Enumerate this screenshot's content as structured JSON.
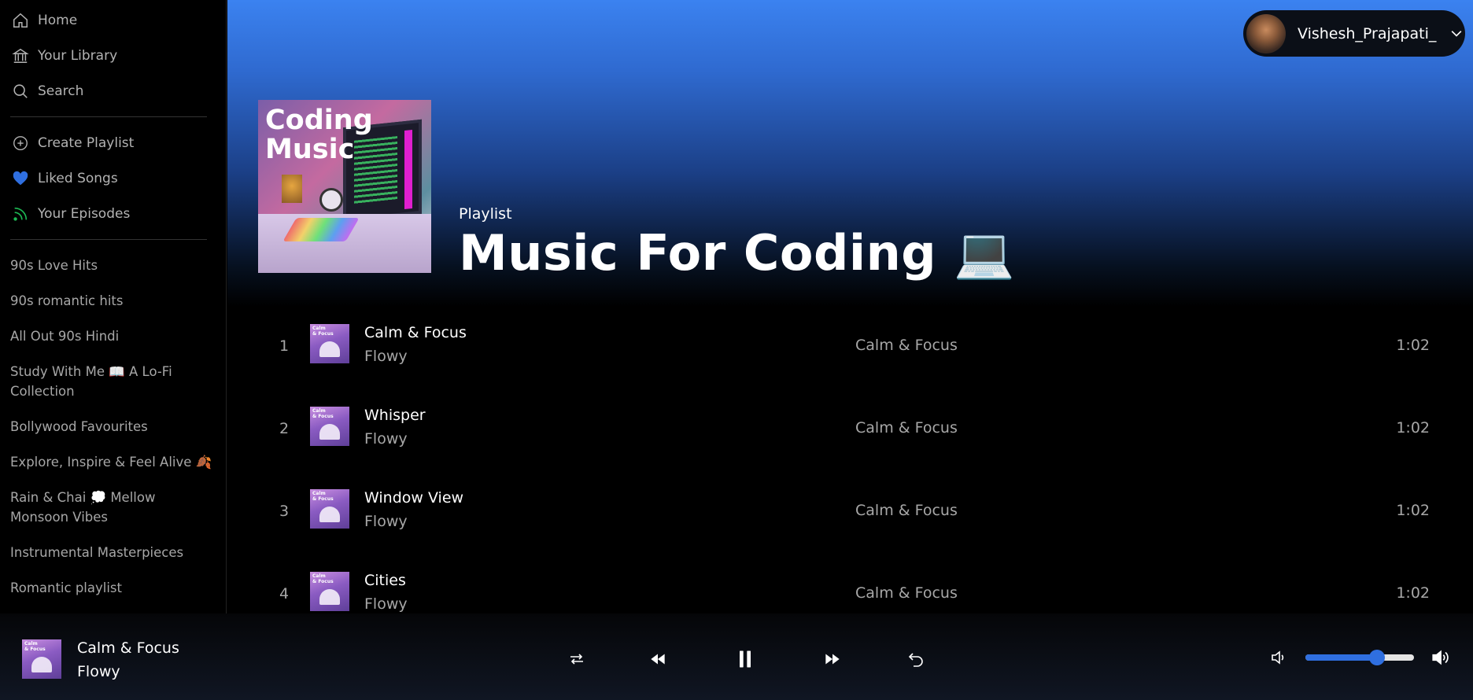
{
  "sidebar": {
    "nav": [
      {
        "label": "Home",
        "icon": "home-icon"
      },
      {
        "label": "Your Library",
        "icon": "library-icon"
      },
      {
        "label": "Search",
        "icon": "search-icon"
      }
    ],
    "actions": [
      {
        "label": "Create Playlist",
        "icon": "plus-circle-icon"
      },
      {
        "label": "Liked Songs",
        "icon": "heart-icon",
        "color": "#2f6fe0"
      },
      {
        "label": "Your Episodes",
        "icon": "rss-icon",
        "color": "#1db954"
      }
    ],
    "playlists": [
      "90s Love Hits",
      "90s romantic hits",
      "All Out 90s Hindi",
      "Study With Me 📖 A Lo-Fi Collection",
      "Bollywood Favourites",
      "Explore, Inspire & Feel Alive 🍂",
      "Rain & Chai 💭 Mellow Monsoon Vibes",
      "Instrumental Masterpieces",
      "Romantic playlist"
    ]
  },
  "header": {
    "user_name": "Vishesh_Prajapati_",
    "cover_title": "Coding\nMusic",
    "type_label": "Playlist",
    "title": "Music For Coding 💻"
  },
  "tracks": [
    {
      "num": "1",
      "title": "Calm & Focus",
      "artist": "Flowy",
      "album": "Calm & Focus",
      "duration": "1:02",
      "art_label": "Calm\n& Focus"
    },
    {
      "num": "2",
      "title": "Whisper",
      "artist": "Flowy",
      "album": "Calm & Focus",
      "duration": "1:02",
      "art_label": "Calm\n& Focus"
    },
    {
      "num": "3",
      "title": "Window View",
      "artist": "Flowy",
      "album": "Calm & Focus",
      "duration": "1:02",
      "art_label": "Calm\n& Focus"
    },
    {
      "num": "4",
      "title": "Cities",
      "artist": "Flowy",
      "album": "Calm & Focus",
      "duration": "1:02",
      "art_label": "Calm\n& Focus"
    }
  ],
  "player": {
    "title": "Calm & Focus",
    "artist": "Flowy",
    "art_label": "Calm\n& Focus",
    "volume": 0.66,
    "accent": "#2f6fe0"
  }
}
